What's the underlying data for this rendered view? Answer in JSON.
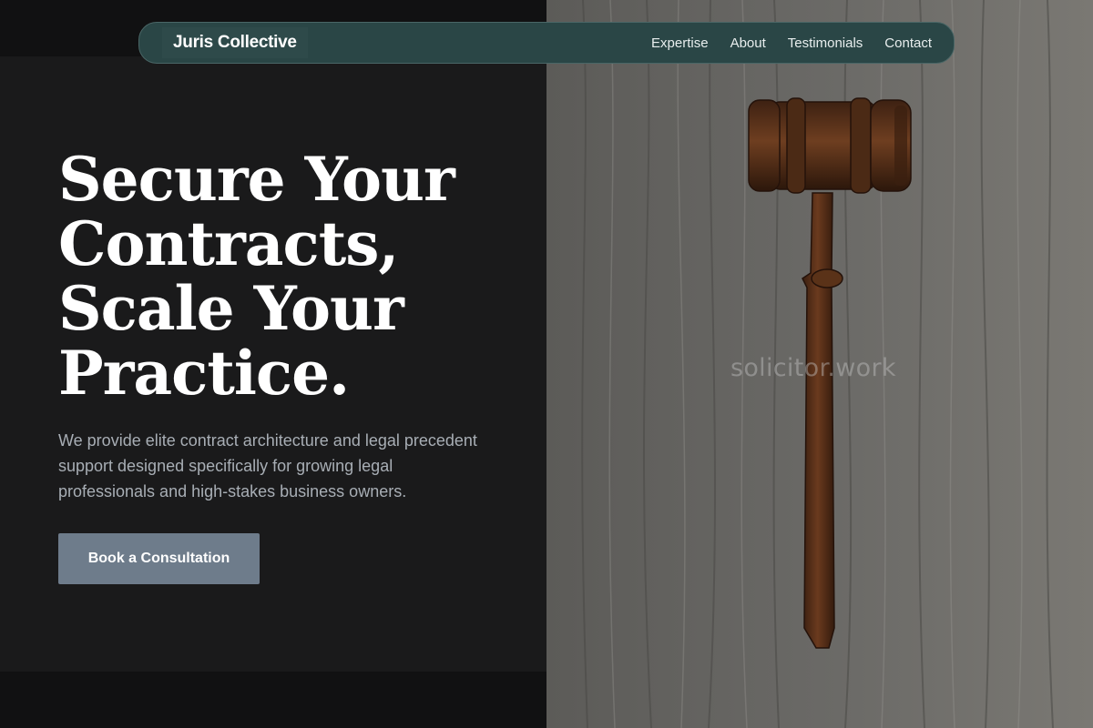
{
  "brand": {
    "name": "Juris Collective"
  },
  "nav": {
    "links": [
      "Expertise",
      "About",
      "Testimonials",
      "Contact"
    ]
  },
  "hero": {
    "title_lines": [
      "Secure Your",
      "Contracts,",
      "Scale Your",
      "Practice."
    ],
    "subtitle": "We provide elite contract architecture and legal precedent support designed specifically for growing legal professionals and high-stakes business owners.",
    "cta_label": "Book a Consultation"
  },
  "image": {
    "subject": "wooden gavel on weathered wood",
    "watermark": "solicitor.work"
  },
  "colors": {
    "page_bg": "#111112",
    "panel_bg": "#1a1a1b",
    "nav_bg": "#2a4646",
    "cta_bg": "#6e7c8b",
    "text_muted": "#a8aeb5"
  }
}
